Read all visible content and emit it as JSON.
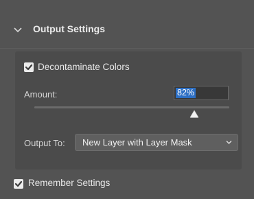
{
  "output_settings": {
    "title": "Output Settings",
    "expanded": true,
    "decontaminate": {
      "label": "Decontaminate Colors",
      "checked": true
    },
    "amount": {
      "label": "Amount:",
      "value": "82%",
      "slider_value": 0.82
    },
    "output_to": {
      "label": "Output To:",
      "selected": "New Layer with Layer Mask"
    }
  },
  "remember": {
    "label": "Remember Settings",
    "checked": true
  },
  "colors": {
    "panel_bg": "#535353",
    "subpanel_bg": "#4b4b4b",
    "selection_blue": "#2d6fc4",
    "checkbox": "#ececec"
  },
  "icons": {
    "section_toggle": "chevron-down-icon",
    "select_arrow": "chevron-down-icon",
    "slider_thumb": "triangle-thumb-icon",
    "checkmark": "checkmark-icon"
  }
}
